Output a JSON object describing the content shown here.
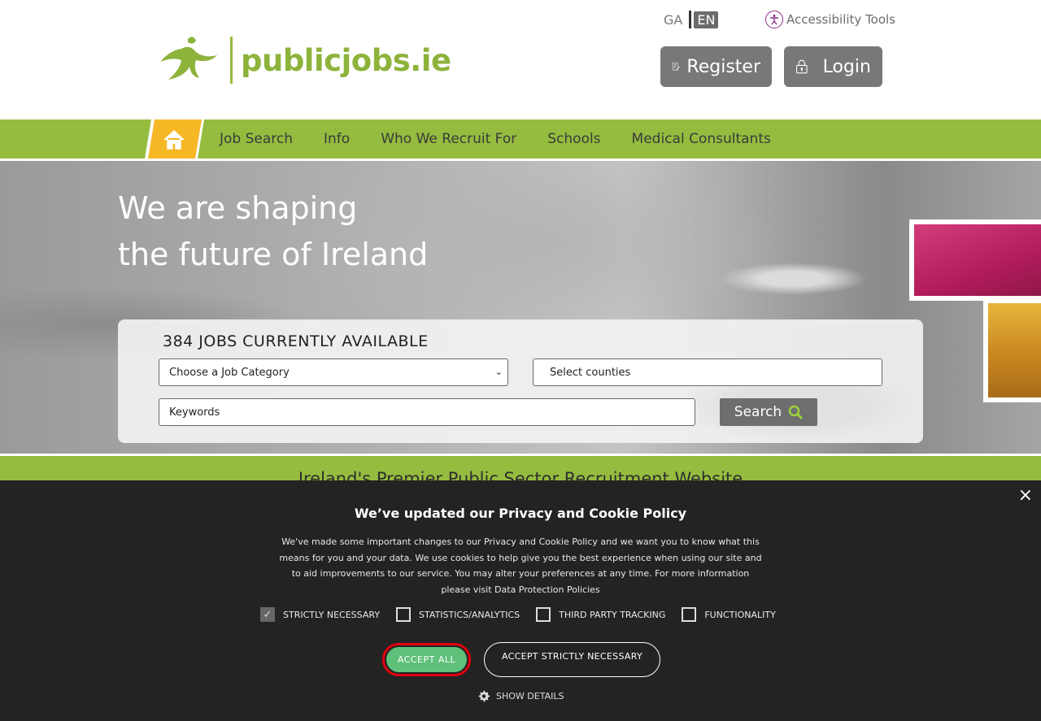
{
  "header": {
    "logo_text": "publicjobs.ie",
    "lang_ga": "GA",
    "lang_en": "EN",
    "accessibility_label": "Accessibility Tools",
    "register_label": "Register",
    "login_label": "Login"
  },
  "nav": {
    "items": [
      {
        "label": "Job Search"
      },
      {
        "label": "Info"
      },
      {
        "label": "Who We Recruit For"
      },
      {
        "label": "Schools"
      },
      {
        "label": "Medical Consultants"
      }
    ]
  },
  "hero": {
    "title_line1": "We are shaping",
    "title_line2": "the future of Ireland"
  },
  "search": {
    "jobs_count": "384 JOBS CURRENTLY AVAILABLE",
    "category_value": "Choose a Job Category",
    "county_value": "Select counties",
    "keywords_placeholder": "Keywords",
    "search_label": "Search"
  },
  "banner": {
    "text": "Ireland's Premier Public Sector Recruitment Website"
  },
  "cookie": {
    "title": "We’ve updated our Privacy and Cookie Policy",
    "body": "We've made some important changes to our Privacy and Cookie Policy and we want you to know what this means for you and your data. We use cookies to help give you the best experience when using our site and to aid improvements to our service. You may alter your preferences at any time. For more information please visit Data Protection Policies",
    "options": [
      {
        "label": "STRICTLY NECESSARY",
        "checked": true
      },
      {
        "label": "STATISTICS/ANALYTICS",
        "checked": false
      },
      {
        "label": "THIRD PARTY TRACKING",
        "checked": false
      },
      {
        "label": "FUNCTIONALITY",
        "checked": false
      }
    ],
    "accept_all_label": "ACCEPT ALL",
    "accept_strict_label": "ACCEPT STRICTLY NECESSARY",
    "show_details_label": "SHOW DETAILS",
    "close_symbol": "×"
  },
  "colors": {
    "brand_green": "#95bc3e",
    "nav_home_yellow": "#f5b724",
    "accept_green": "#5fc07a",
    "focus_red": "#e0000f"
  }
}
